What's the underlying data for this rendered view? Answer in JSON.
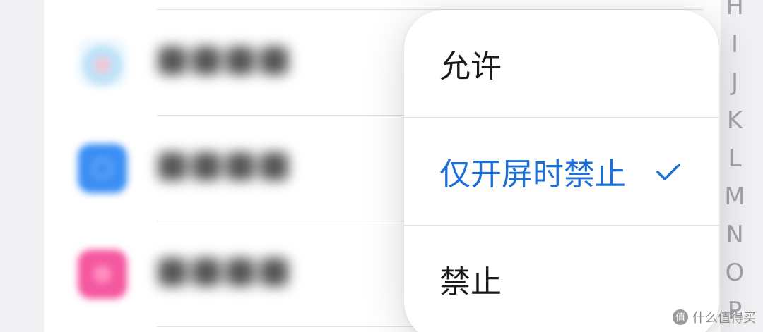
{
  "app_list": {
    "items": [
      {
        "name_placeholder": "blurred",
        "icon_color": "#d6eefc",
        "icon": "cloud-app-icon"
      },
      {
        "name_placeholder": "blurred",
        "icon_color": "#3b8ef5",
        "icon": "compass-app-icon"
      },
      {
        "name_placeholder": "blurred",
        "icon_color": "#f558a0",
        "icon": "pink-app-icon"
      }
    ]
  },
  "index_bar": {
    "letters": [
      "H",
      "I",
      "J",
      "K",
      "L",
      "M",
      "N",
      "O",
      "P"
    ]
  },
  "popup_menu": {
    "options": [
      {
        "label": "允许",
        "selected": false
      },
      {
        "label": "仅开屏时禁止",
        "selected": true
      },
      {
        "label": "禁止",
        "selected": false
      }
    ],
    "accent_color": "#1d6fd8"
  },
  "watermark": {
    "badge": "值",
    "text": "什么值得买"
  }
}
